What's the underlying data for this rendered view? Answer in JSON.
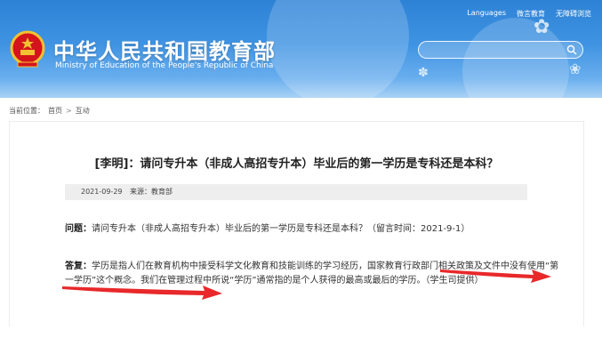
{
  "header": {
    "title_cn": "中华人民共和国教育部",
    "title_en": "Ministry of Education of the People's Republic of China",
    "links": [
      "Languages",
      "微言教育",
      "无障碍浏览"
    ],
    "search_placeholder": ""
  },
  "breadcrumb": {
    "label": "当前位置：",
    "items": [
      "首页",
      "互动"
    ],
    "separator": ">"
  },
  "article": {
    "title": "[李明]：请问专升本（非成人高招专升本）毕业后的第一学历是专科还是本科？",
    "date": "2021-09-29",
    "source": "来源：教育部",
    "question_label": "问题：",
    "question_text": "请问专升本（非成人高招专升本）毕业后的第一学历是专科还是本科？（留言时间：2021-9-1）",
    "answer_label": "答复：",
    "answer_text": "学历是指人们在教育机构中接受科学文化教育和技能训练的学习经历，国家教育行政部门相关政策及文件中没有使用“第一学历”这个概念。我们在管理过程中所说“学历”通常指的是个人获得的最高或最后的学历。（学生司提供）"
  },
  "colors": {
    "header_blue": "#2e82d6",
    "annotation_red": "#e8282a"
  },
  "icons": [
    "national-emblem",
    "search-icon",
    "chevron-right"
  ]
}
